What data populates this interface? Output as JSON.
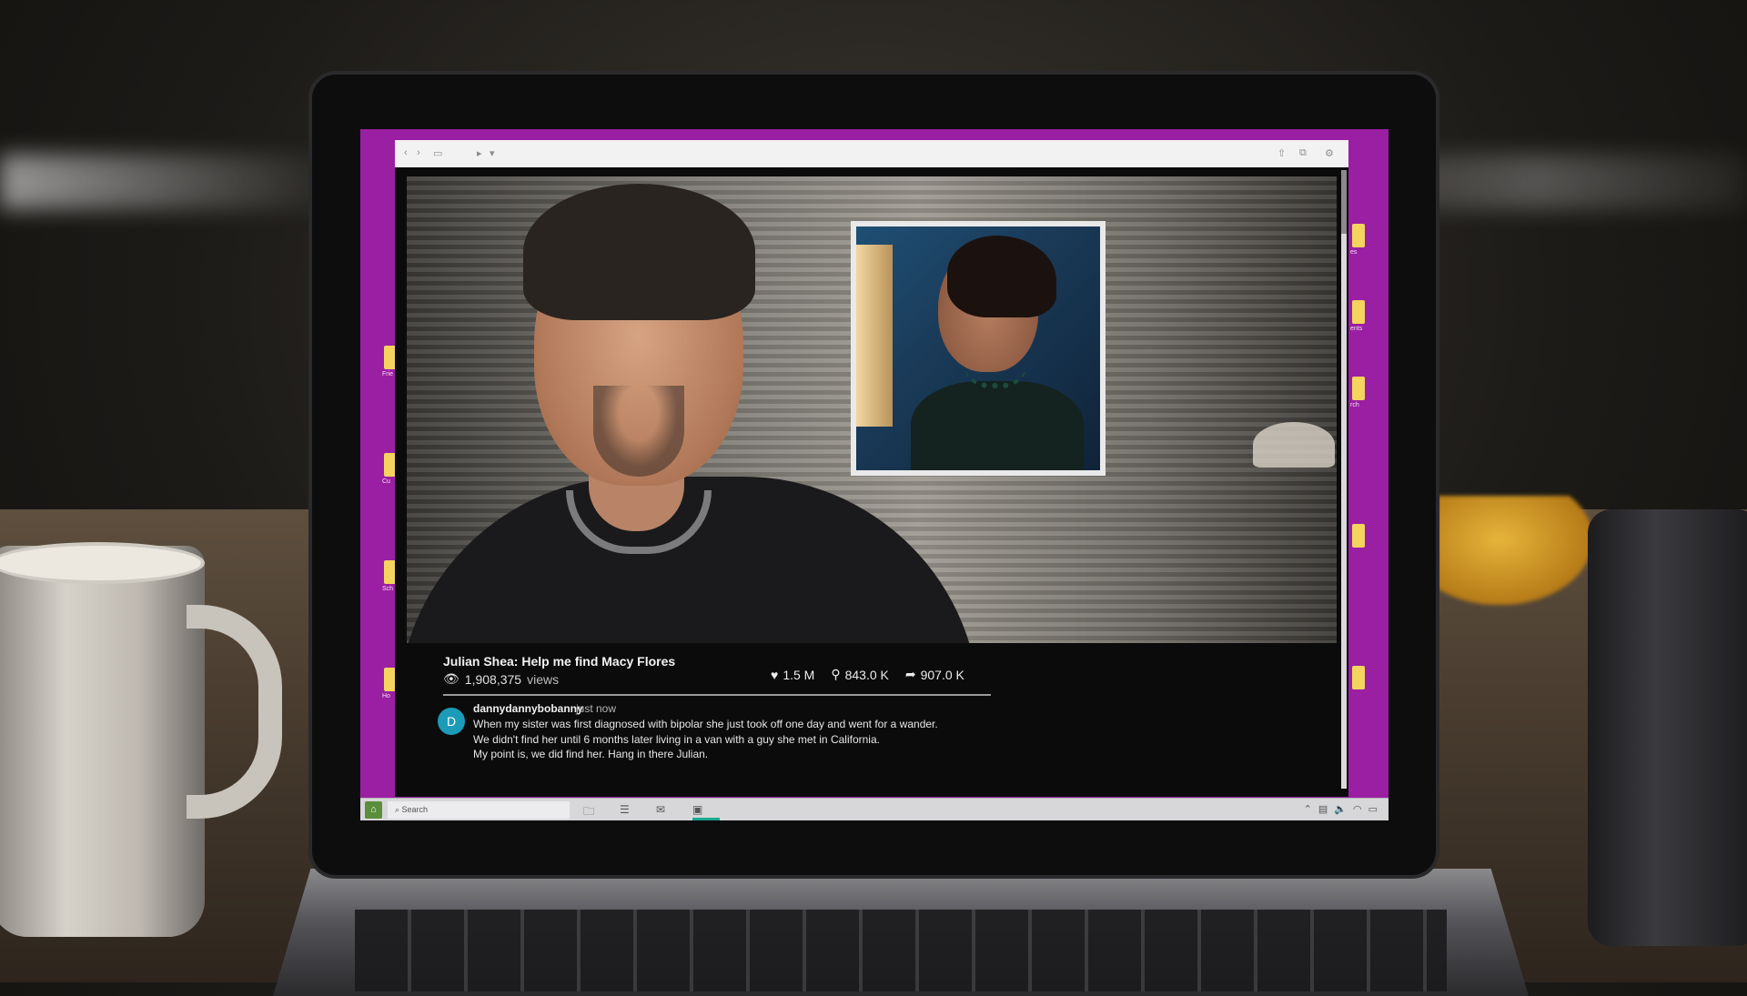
{
  "browser": {
    "toolbar_icons": [
      "back-icon",
      "forward-icon",
      "sidebar-icon",
      "cursor-icon",
      "share-icon",
      "tabs-icon",
      "settings-icon"
    ]
  },
  "video": {
    "title": "Julian Shea: Help me find Macy Flores",
    "views_count": "1,908,375",
    "views_label": "views",
    "likes": "1.5 M",
    "follows": "843.0 K",
    "shares": "907.0 K"
  },
  "comment": {
    "avatar_letter": "D",
    "avatar_color": "#1b9bb8",
    "username": "dannydannybobanny",
    "time": "just now",
    "lines": [
      "When my sister was first diagnosed with bipolar she just took off one day and went for a wander.",
      "We didn't find her until 6 months later living in a van with a guy she met in California.",
      "My point is, we did find her.  Hang in there Julian."
    ]
  },
  "taskbar": {
    "search_label": "Search",
    "active_color": "#18a88f"
  },
  "desktop": {
    "background_color": "#9b1fa3",
    "left_icons": [
      "Frie",
      "Cu",
      "Sch",
      "Ho"
    ],
    "right_icons": [
      "es",
      "ents",
      "rch",
      "",
      ""
    ]
  }
}
